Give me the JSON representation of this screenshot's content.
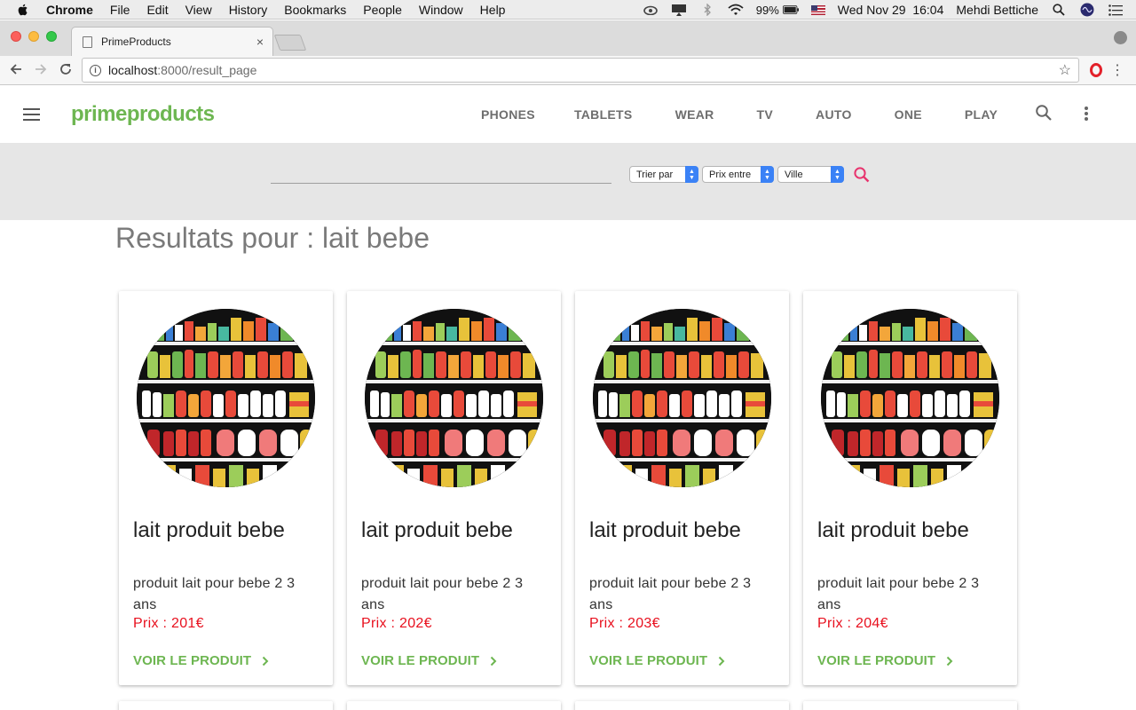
{
  "menubar": {
    "app_name": "Chrome",
    "items": [
      "File",
      "Edit",
      "View",
      "History",
      "Bookmarks",
      "People",
      "Window",
      "Help"
    ],
    "battery": "99%",
    "datetime": "Wed Nov 29  16:04",
    "user": "Mehdi Bettiche"
  },
  "browser": {
    "tab_title": "PrimeProducts",
    "tab_close": "×",
    "url_host": "localhost",
    "url_rest": ":8000/result_page"
  },
  "header": {
    "brand": "primeproducts",
    "nav": [
      "PHONES",
      "TABLETS",
      "WEAR",
      "TV",
      "AUTO",
      "ONE",
      "PLAY"
    ]
  },
  "filters": {
    "search_value": "",
    "sort_label": "Trier par",
    "price_label": "Prix entre",
    "city_label": "Ville"
  },
  "results": {
    "heading": "Resultats pour : lait bebe",
    "action_label": "VOIR LE PRODUIT",
    "products": [
      {
        "title": "lait produit bebe",
        "description": "produit lait pour bebe 2 3 ans",
        "price": "Prix : 201€"
      },
      {
        "title": "lait produit bebe",
        "description": "produit lait pour bebe 2 3 ans",
        "price": "Prix : 202€"
      },
      {
        "title": "lait produit bebe",
        "description": "produit lait pour bebe 2 3 ans",
        "price": "Prix : 203€"
      },
      {
        "title": "lait produit bebe",
        "description": "produit lait pour bebe 2 3 ans",
        "price": "Prix : 204€"
      }
    ]
  },
  "colors": {
    "brand_green": "#6db651",
    "price_red": "#e8101e",
    "search_pink": "#e8336d"
  }
}
